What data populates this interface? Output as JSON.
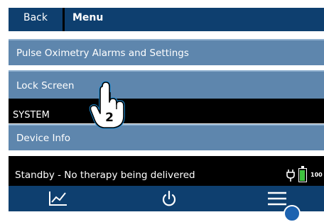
{
  "header": {
    "back_label": "Back",
    "title": "Menu"
  },
  "menu_items": [
    {
      "label": "Pulse Oximetry Alarms and Settings"
    },
    {
      "label": "Lock Screen"
    }
  ],
  "section_label": "SYSTEM",
  "system_items": [
    {
      "label": "Device Info"
    }
  ],
  "status": {
    "text": "Standby - No therapy being delivered",
    "battery_text": "100",
    "battery_level": 1.0
  },
  "navbar": {
    "buttons": [
      {
        "icon": "trend-chart-icon"
      },
      {
        "icon": "power-icon"
      },
      {
        "icon": "hamburger-menu-icon"
      }
    ]
  },
  "annotation": {
    "step_number": "2"
  },
  "colors": {
    "header_bg": "#0e3f6f",
    "menu_item_bg": "#5e86ad",
    "screen_bg": "#000000",
    "battery_green": "#3fc33f",
    "text": "#ffffff"
  }
}
